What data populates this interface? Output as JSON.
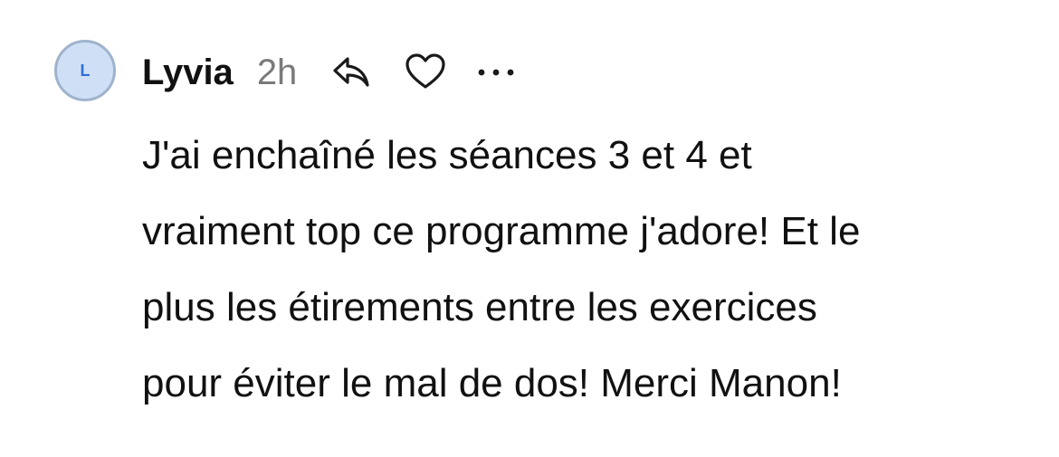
{
  "comment": {
    "avatar_initial": "L",
    "author": "Lyvia",
    "time": "2h",
    "icons": {
      "reply": "reply-icon",
      "like": "heart-icon",
      "more": "more-icon"
    },
    "text_lines": [
      "J'ai enchaîné les séances 3 et 4 et",
      "vraiment top ce programme j'adore! Et le",
      "plus les étirements entre les exercices",
      "pour éviter le mal de dos! Merci Manon!"
    ]
  },
  "colors": {
    "avatar_bg": "#cfe0f6",
    "avatar_text": "#2f6fd6",
    "muted_text": "#7a7a7a"
  }
}
